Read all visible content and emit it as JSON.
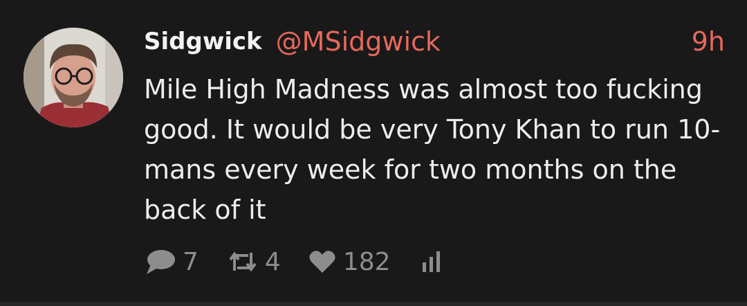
{
  "tweet": {
    "display_name": "Sidgwick",
    "handle": "@MSidgwick",
    "time": "9h",
    "text": "Mile High Madness was almost too fucking good. It would be very Tony Khan to run 10-mans every week for two months on the back of it",
    "reply_count": "7",
    "retweet_count": "4",
    "like_count": "182"
  },
  "icons": {
    "reply": "speech-bubble-icon",
    "retweet": "retweet-icon",
    "like": "heart-icon",
    "stats": "bar-chart-icon"
  },
  "colors": {
    "background": "#191919",
    "accent": "#e8685c",
    "text": "#ededed",
    "muted": "#8d8d8d"
  }
}
